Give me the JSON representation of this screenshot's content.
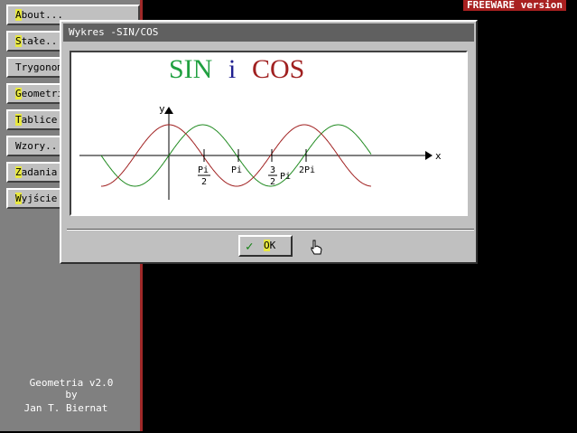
{
  "banner": "FREEWARE version",
  "menu": {
    "items": [
      {
        "hot": "A",
        "rest": "bout..."
      },
      {
        "hot": "S",
        "rest": "tałe..."
      },
      {
        "hot": "T",
        "rest": "rygonometria"
      },
      {
        "hot": "G",
        "rest": "eometria"
      },
      {
        "hot": "T",
        "rest": "ablice"
      },
      {
        "hot": "W",
        "rest": "zory..."
      },
      {
        "hot": "Z",
        "rest": "adania"
      },
      {
        "hot": "W",
        "rest": "yjście"
      }
    ]
  },
  "credits": {
    "line1": "Geometria v2.0",
    "line2": "by",
    "line3": "Jan T. Biernat"
  },
  "dialog": {
    "title": "Wykres -SIN/COS",
    "ok_hot": "O",
    "ok_rest": "K"
  },
  "chart_data": {
    "type": "line",
    "title_parts": [
      "SIN",
      "i",
      "COS"
    ],
    "xlabel": "x",
    "ylabel": "y",
    "tick_labels": [
      "Pi/2",
      "Pi",
      "3/2 Pi",
      "2Pi"
    ],
    "series": [
      {
        "color": "#208a20",
        "values_fn": "sin(x)"
      },
      {
        "color": "#a02020",
        "values_fn": "cos(x)"
      }
    ],
    "colors": {
      "sin_title": "#20a040",
      "i_title": "#202090",
      "cos_title": "#a02020"
    }
  }
}
